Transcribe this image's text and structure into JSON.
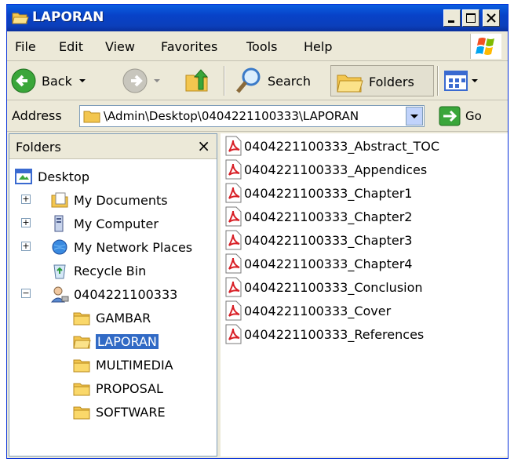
{
  "window": {
    "title": "LAPORAN"
  },
  "menu": [
    "File",
    "Edit",
    "View",
    "Favorites",
    "Tools",
    "Help"
  ],
  "toolbar": {
    "back_label": "Back",
    "search_label": "Search",
    "folders_label": "Folders"
  },
  "address": {
    "label": "Address",
    "path": "\\Admin\\Desktop\\0404221100333\\LAPORAN",
    "go_label": "Go"
  },
  "folders_pane": {
    "title": "Folders",
    "close": "×",
    "tree": [
      {
        "label": "Desktop",
        "icon": "desktop-icon"
      },
      {
        "label": "My Documents",
        "icon": "my-documents-icon",
        "expander": "+"
      },
      {
        "label": "My Computer",
        "icon": "my-computer-icon",
        "expander": "+"
      },
      {
        "label": "My Network Places",
        "icon": "network-places-icon",
        "expander": "+"
      },
      {
        "label": "Recycle Bin",
        "icon": "recycle-bin-icon"
      },
      {
        "label": "0404221100333",
        "icon": "user-folder-icon",
        "expander": "−"
      },
      {
        "label": "GAMBAR",
        "icon": "folder-icon"
      },
      {
        "label": "LAPORAN",
        "icon": "folder-open-icon",
        "selected": true
      },
      {
        "label": "MULTIMEDIA",
        "icon": "folder-icon"
      },
      {
        "label": "PROPOSAL",
        "icon": "folder-icon"
      },
      {
        "label": "SOFTWARE",
        "icon": "folder-icon"
      }
    ]
  },
  "files": [
    "0404221100333_Abstract_TOC",
    "0404221100333_Appendices",
    "0404221100333_Chapter1",
    "0404221100333_Chapter2",
    "0404221100333_Chapter3",
    "0404221100333_Chapter4",
    "0404221100333_Conclusion",
    "0404221100333_Cover",
    "0404221100333_References"
  ],
  "colors": {
    "titlebar": "#0842c8",
    "selection": "#316ac5",
    "pdf_red": "#d81f26"
  }
}
